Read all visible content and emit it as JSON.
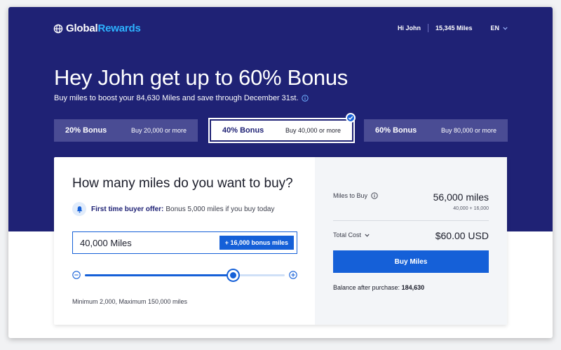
{
  "brand": {
    "name_part1": "Global",
    "name_part2": "Rewards"
  },
  "topnav": {
    "greeting": "Hi John",
    "miles": "15,345 Miles",
    "language": "EN"
  },
  "hero": {
    "headline": "Hey John get up to 60% Bonus",
    "subline": "Buy miles to boost your 84,630 Miles and save through December 31st."
  },
  "tiers": [
    {
      "name": "20% Bonus",
      "requirement": "Buy 20,000 or more",
      "selected": false
    },
    {
      "name": "40% Bonus",
      "requirement": "Buy 40,000 or more",
      "selected": true
    },
    {
      "name": "60% Bonus",
      "requirement": "Buy 80,000 or more",
      "selected": false
    }
  ],
  "purchase": {
    "question": "How many miles do you want to buy?",
    "offer_label": "First time buyer offer:",
    "offer_text": "Bonus 5,000 miles if you buy today",
    "input_value": "40,000 Miles",
    "bonus_pill": "+ 16,000 bonus miles",
    "slider_level": 0.74,
    "range_note": "Minimum 2,000, Maximum 150,000 miles"
  },
  "summary": {
    "miles_to_buy_label": "Miles to Buy",
    "miles_to_buy_value": "56,000 miles",
    "miles_breakdown": "40,000 + 16,000",
    "total_cost_label": "Total Cost",
    "total_cost_value": "$60.00 USD",
    "buy_button": "Buy Miles",
    "balance_label": "Balance after purchase:",
    "balance_value": "184,630"
  },
  "colors": {
    "hero_bg": "#1f2275",
    "tier_bg": "#4a4c94",
    "accent_blue": "#1560d8",
    "brand_accent": "#2db2ff",
    "summary_bg": "#f3f5f8"
  },
  "icons": {
    "logo": "globe-icon",
    "language_dropdown": "chevron-down-icon",
    "subline_info": "info-icon",
    "selected_tier": "check-icon",
    "offer": "bell-icon",
    "slider_decrease": "minus-circle-icon",
    "slider_increase": "plus-circle-icon",
    "miles_info": "info-icon",
    "total_cost_toggle": "chevron-down-icon"
  }
}
